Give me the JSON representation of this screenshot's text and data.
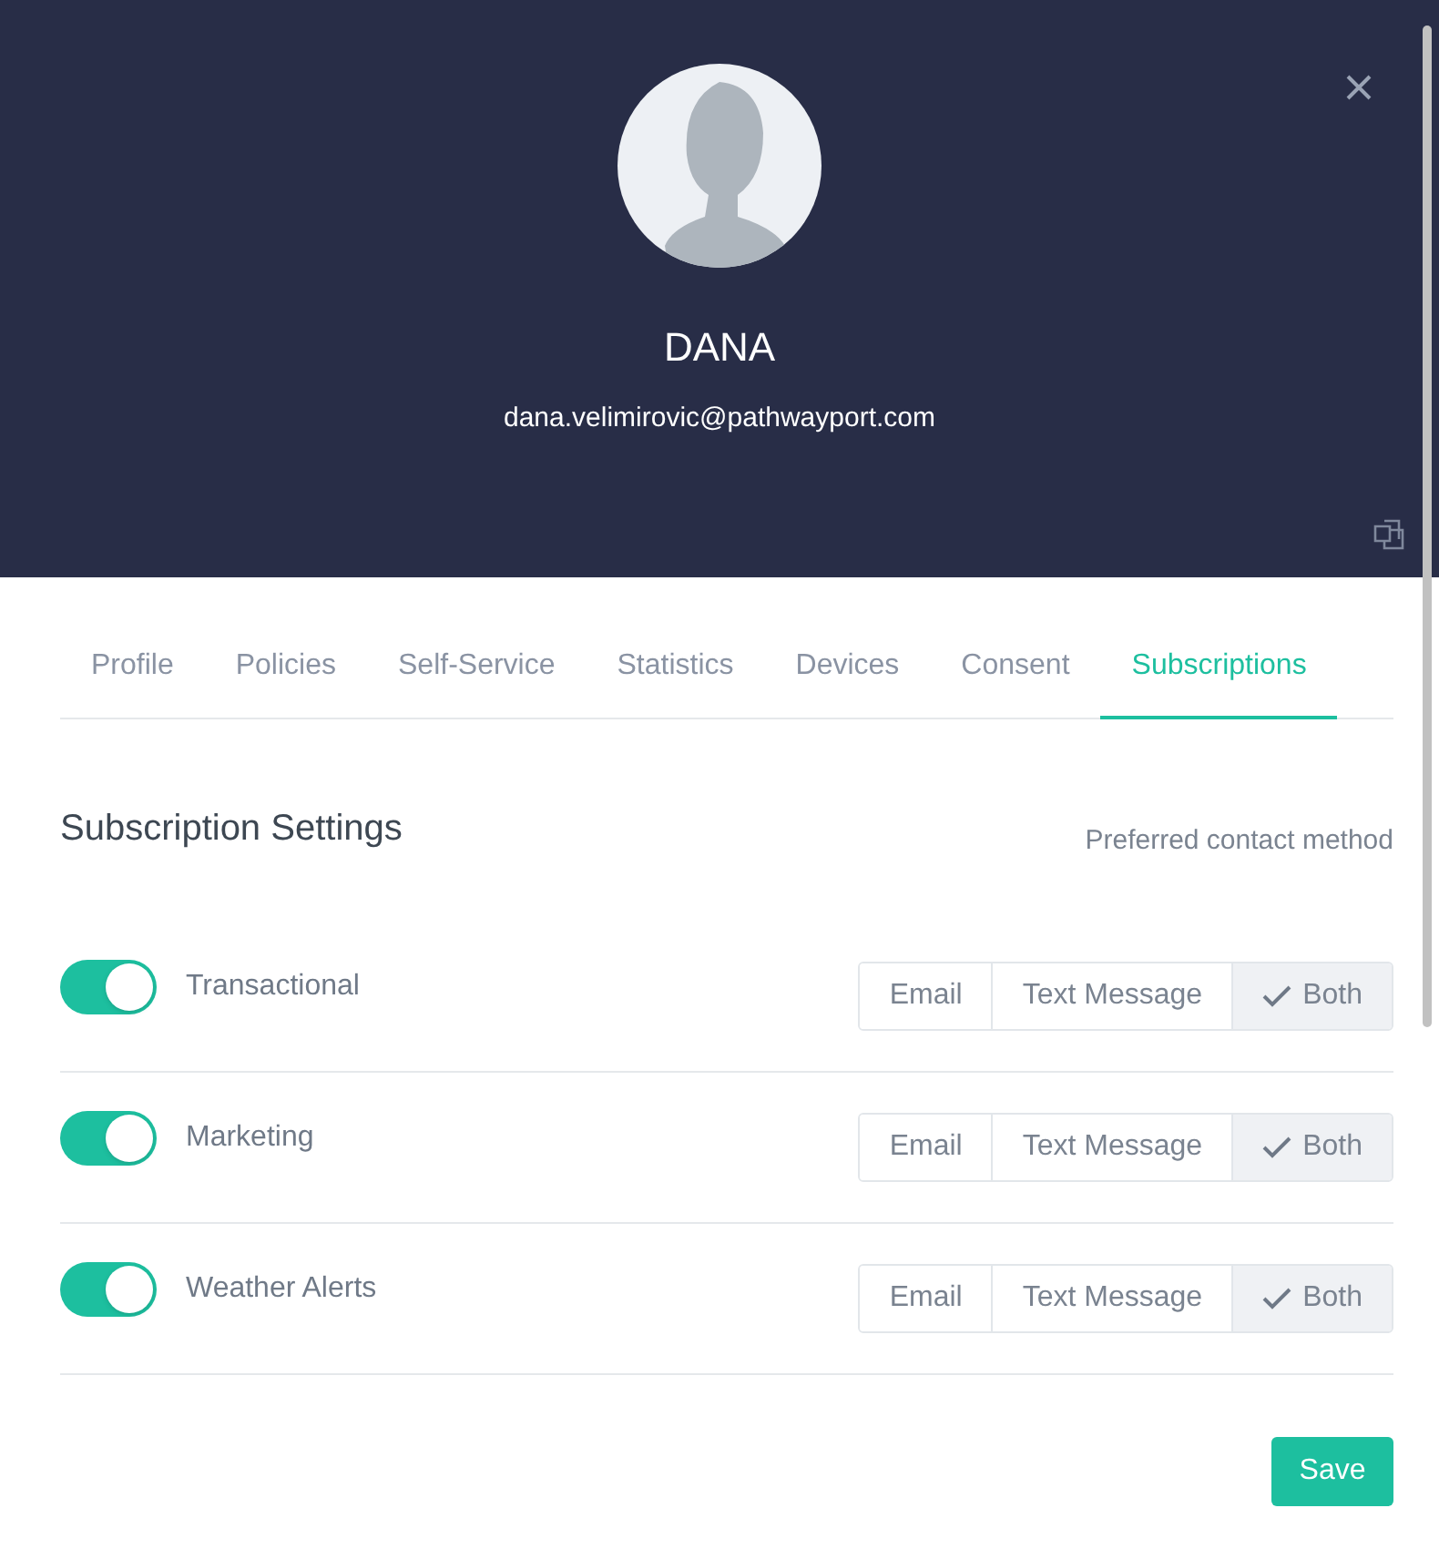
{
  "header": {
    "name": "DANA",
    "email": "dana.velimirovic@pathwayport.com"
  },
  "tabs": [
    {
      "label": "Profile",
      "selected": false
    },
    {
      "label": "Policies",
      "selected": false
    },
    {
      "label": "Self-Service",
      "selected": false
    },
    {
      "label": "Statistics",
      "selected": false
    },
    {
      "label": "Devices",
      "selected": false
    },
    {
      "label": "Consent",
      "selected": false
    },
    {
      "label": "Subscriptions",
      "selected": true
    }
  ],
  "section": {
    "title": "Subscription Settings",
    "method_label": "Preferred contact method"
  },
  "subscriptions": [
    {
      "name": "Transactional",
      "on": true,
      "options": [
        {
          "label": "Email",
          "selected": false
        },
        {
          "label": "Text Message",
          "selected": false
        },
        {
          "label": "Both",
          "selected": true
        }
      ]
    },
    {
      "name": "Marketing",
      "on": true,
      "options": [
        {
          "label": "Email",
          "selected": false
        },
        {
          "label": "Text Message",
          "selected": false
        },
        {
          "label": "Both",
          "selected": true
        }
      ]
    },
    {
      "name": "Weather Alerts",
      "on": true,
      "options": [
        {
          "label": "Email",
          "selected": false
        },
        {
          "label": "Text Message",
          "selected": false
        },
        {
          "label": "Both",
          "selected": true
        }
      ]
    }
  ],
  "save_button": "Save"
}
